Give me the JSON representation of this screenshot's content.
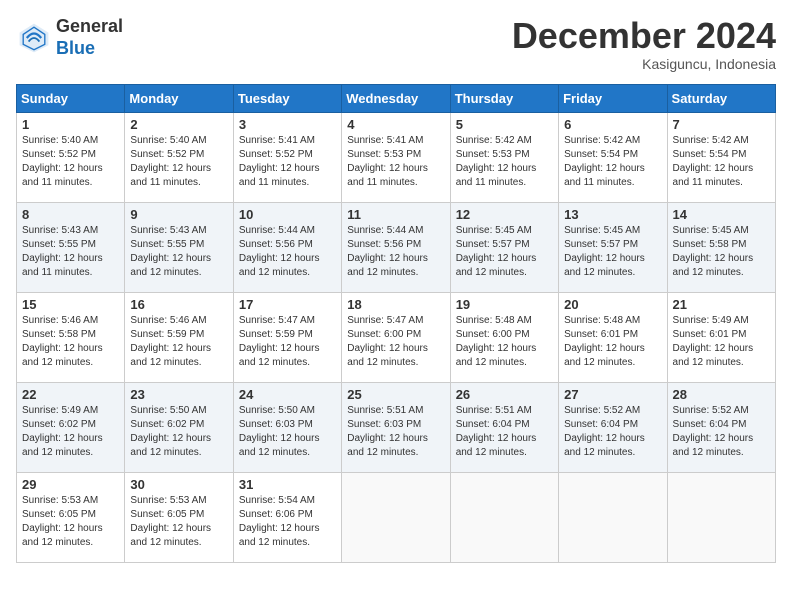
{
  "header": {
    "logo_line1": "General",
    "logo_line2": "Blue",
    "month": "December 2024",
    "location": "Kasiguncu, Indonesia"
  },
  "days_of_week": [
    "Sunday",
    "Monday",
    "Tuesday",
    "Wednesday",
    "Thursday",
    "Friday",
    "Saturday"
  ],
  "weeks": [
    [
      {
        "day": "1",
        "sunrise": "5:40 AM",
        "sunset": "5:52 PM",
        "daylight": "12 hours and 11 minutes."
      },
      {
        "day": "2",
        "sunrise": "5:40 AM",
        "sunset": "5:52 PM",
        "daylight": "12 hours and 11 minutes."
      },
      {
        "day": "3",
        "sunrise": "5:41 AM",
        "sunset": "5:52 PM",
        "daylight": "12 hours and 11 minutes."
      },
      {
        "day": "4",
        "sunrise": "5:41 AM",
        "sunset": "5:53 PM",
        "daylight": "12 hours and 11 minutes."
      },
      {
        "day": "5",
        "sunrise": "5:42 AM",
        "sunset": "5:53 PM",
        "daylight": "12 hours and 11 minutes."
      },
      {
        "day": "6",
        "sunrise": "5:42 AM",
        "sunset": "5:54 PM",
        "daylight": "12 hours and 11 minutes."
      },
      {
        "day": "7",
        "sunrise": "5:42 AM",
        "sunset": "5:54 PM",
        "daylight": "12 hours and 11 minutes."
      }
    ],
    [
      {
        "day": "8",
        "sunrise": "5:43 AM",
        "sunset": "5:55 PM",
        "daylight": "12 hours and 11 minutes."
      },
      {
        "day": "9",
        "sunrise": "5:43 AM",
        "sunset": "5:55 PM",
        "daylight": "12 hours and 12 minutes."
      },
      {
        "day": "10",
        "sunrise": "5:44 AM",
        "sunset": "5:56 PM",
        "daylight": "12 hours and 12 minutes."
      },
      {
        "day": "11",
        "sunrise": "5:44 AM",
        "sunset": "5:56 PM",
        "daylight": "12 hours and 12 minutes."
      },
      {
        "day": "12",
        "sunrise": "5:45 AM",
        "sunset": "5:57 PM",
        "daylight": "12 hours and 12 minutes."
      },
      {
        "day": "13",
        "sunrise": "5:45 AM",
        "sunset": "5:57 PM",
        "daylight": "12 hours and 12 minutes."
      },
      {
        "day": "14",
        "sunrise": "5:45 AM",
        "sunset": "5:58 PM",
        "daylight": "12 hours and 12 minutes."
      }
    ],
    [
      {
        "day": "15",
        "sunrise": "5:46 AM",
        "sunset": "5:58 PM",
        "daylight": "12 hours and 12 minutes."
      },
      {
        "day": "16",
        "sunrise": "5:46 AM",
        "sunset": "5:59 PM",
        "daylight": "12 hours and 12 minutes."
      },
      {
        "day": "17",
        "sunrise": "5:47 AM",
        "sunset": "5:59 PM",
        "daylight": "12 hours and 12 minutes."
      },
      {
        "day": "18",
        "sunrise": "5:47 AM",
        "sunset": "6:00 PM",
        "daylight": "12 hours and 12 minutes."
      },
      {
        "day": "19",
        "sunrise": "5:48 AM",
        "sunset": "6:00 PM",
        "daylight": "12 hours and 12 minutes."
      },
      {
        "day": "20",
        "sunrise": "5:48 AM",
        "sunset": "6:01 PM",
        "daylight": "12 hours and 12 minutes."
      },
      {
        "day": "21",
        "sunrise": "5:49 AM",
        "sunset": "6:01 PM",
        "daylight": "12 hours and 12 minutes."
      }
    ],
    [
      {
        "day": "22",
        "sunrise": "5:49 AM",
        "sunset": "6:02 PM",
        "daylight": "12 hours and 12 minutes."
      },
      {
        "day": "23",
        "sunrise": "5:50 AM",
        "sunset": "6:02 PM",
        "daylight": "12 hours and 12 minutes."
      },
      {
        "day": "24",
        "sunrise": "5:50 AM",
        "sunset": "6:03 PM",
        "daylight": "12 hours and 12 minutes."
      },
      {
        "day": "25",
        "sunrise": "5:51 AM",
        "sunset": "6:03 PM",
        "daylight": "12 hours and 12 minutes."
      },
      {
        "day": "26",
        "sunrise": "5:51 AM",
        "sunset": "6:04 PM",
        "daylight": "12 hours and 12 minutes."
      },
      {
        "day": "27",
        "sunrise": "5:52 AM",
        "sunset": "6:04 PM",
        "daylight": "12 hours and 12 minutes."
      },
      {
        "day": "28",
        "sunrise": "5:52 AM",
        "sunset": "6:04 PM",
        "daylight": "12 hours and 12 minutes."
      }
    ],
    [
      {
        "day": "29",
        "sunrise": "5:53 AM",
        "sunset": "6:05 PM",
        "daylight": "12 hours and 12 minutes."
      },
      {
        "day": "30",
        "sunrise": "5:53 AM",
        "sunset": "6:05 PM",
        "daylight": "12 hours and 12 minutes."
      },
      {
        "day": "31",
        "sunrise": "5:54 AM",
        "sunset": "6:06 PM",
        "daylight": "12 hours and 12 minutes."
      },
      null,
      null,
      null,
      null
    ]
  ]
}
